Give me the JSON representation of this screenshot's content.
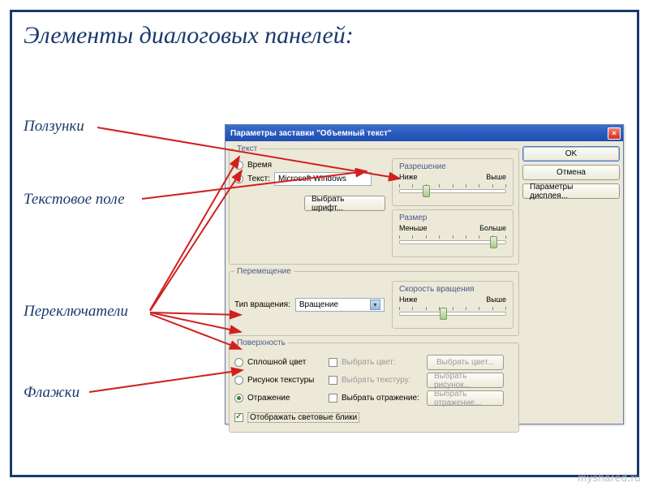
{
  "slide": {
    "title": "Элементы диалоговых панелей:",
    "labels": {
      "sliders": "Ползунки",
      "textfield": "Текстовое поле",
      "radios": "Переключатели",
      "checkboxes": "Флажки"
    },
    "watermark_pre": "myshared",
    "watermark_accent": ".",
    "watermark_post": "ru"
  },
  "dialog": {
    "title": "Параметры заставки \"Объемный текст\"",
    "buttons": {
      "ok": "OK",
      "cancel": "Отмена",
      "display": "Параметры дисплея..."
    },
    "groups": {
      "text": {
        "legend": "Текст",
        "radio_time": "Время",
        "radio_text": "Текст:",
        "value": "Microsoft Windows",
        "choose_font": "Выбрать шрифт..."
      },
      "resolution": {
        "legend": "Разрешение",
        "low": "Ниже",
        "high": "Выше"
      },
      "size": {
        "legend": "Размер",
        "low": "Меньше",
        "high": "Больше"
      },
      "movement": {
        "legend": "Перемещение",
        "type_label": "Тип вращения:",
        "type_value": "Вращение"
      },
      "speed": {
        "legend": "Скорость вращения",
        "low": "Ниже",
        "high": "Выше"
      },
      "surface": {
        "legend": "Поверхность",
        "radio_solid": "Сплошной цвет",
        "radio_texture": "Рисунок текстуры",
        "radio_reflection": "Отражение",
        "cb_choose_color": "Выбрать цвет:",
        "cb_choose_texture": "Выбрать текстуру:",
        "cb_choose_reflection": "Выбрать отражение:",
        "btn_choose_color": "Выбрать цвет...",
        "btn_choose_texture": "Выбрать рисунок...",
        "btn_choose_reflection": "Выбрать отражение...",
        "cb_highlights": "Отображать световые блики"
      }
    }
  }
}
